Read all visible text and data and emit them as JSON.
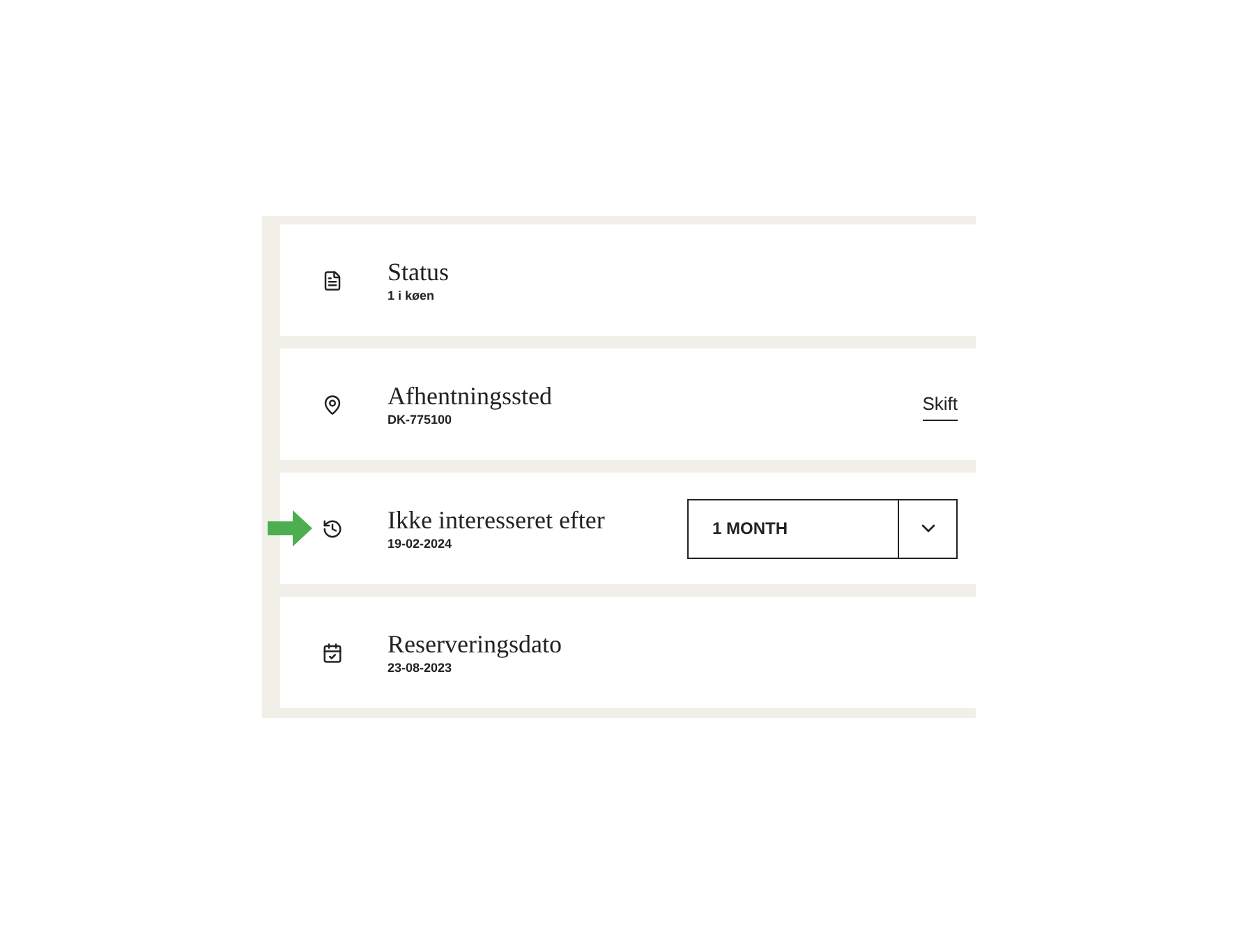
{
  "rows": [
    {
      "kind": "plain",
      "title": "Status",
      "subtitle": "1 i køen",
      "highlighted": false
    },
    {
      "kind": "link",
      "title": "Afhentningssted",
      "subtitle": "DK-775100",
      "link": "Skift",
      "highlighted": false
    },
    {
      "kind": "select",
      "title": "Ikke interesseret efter",
      "subtitle": "19-02-2024",
      "value": "1 MONTH",
      "highlighted": true
    },
    {
      "kind": "plain",
      "title": "Reserveringsdato",
      "subtitle": "23-08-2023",
      "highlighted": false
    }
  ]
}
